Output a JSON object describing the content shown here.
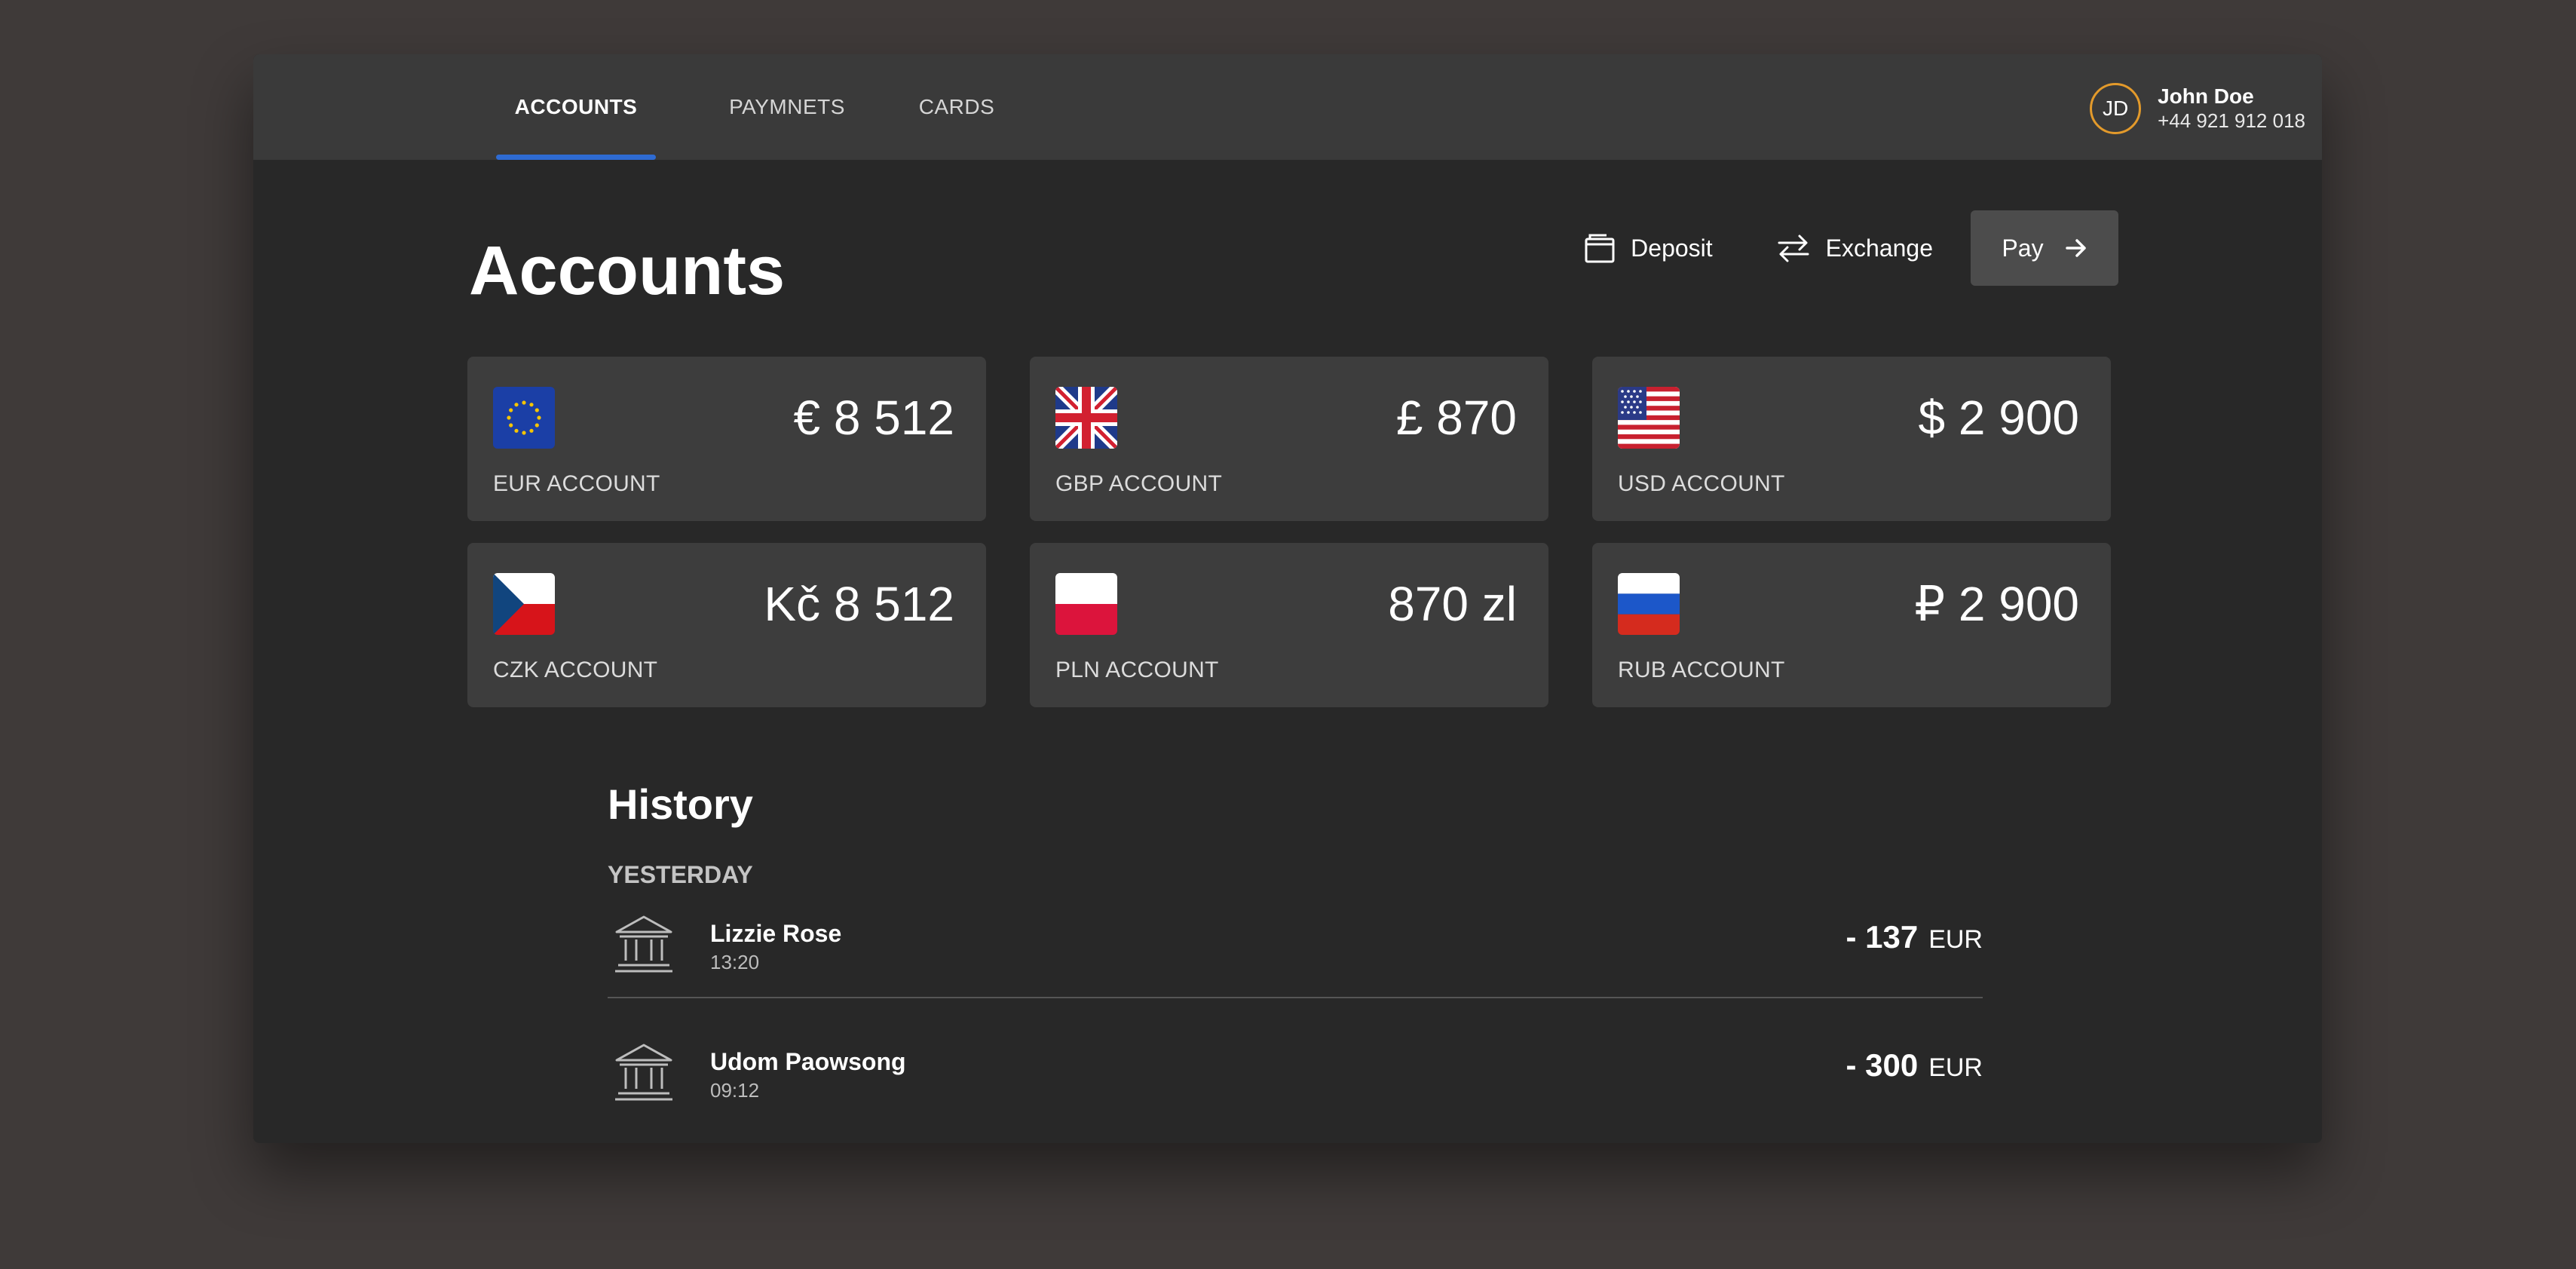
{
  "nav": {
    "tabs": [
      {
        "label": "ACCOUNTS",
        "active": true
      },
      {
        "label": "PAYMNETS",
        "active": false
      },
      {
        "label": "CARDS",
        "active": false
      }
    ]
  },
  "user": {
    "initials": "JD",
    "name": "John Doe",
    "phone": "+44 921 912 018"
  },
  "page": {
    "title": "Accounts"
  },
  "actions": {
    "deposit_label": "Deposit",
    "exchange_label": "Exchange",
    "pay_label": "Pay"
  },
  "accounts": [
    {
      "flag": "eu-flag-icon",
      "amount": "€ 8 512",
      "label": "EUR ACCOUNT"
    },
    {
      "flag": "uk-flag-icon",
      "amount": "£ 870",
      "label": "GBP ACCOUNT"
    },
    {
      "flag": "us-flag-icon",
      "amount": "$ 2 900",
      "label": "USD ACCOUNT"
    },
    {
      "flag": "cz-flag-icon",
      "amount": "Kč 8 512",
      "label": "CZK ACCOUNT"
    },
    {
      "flag": "pl-flag-icon",
      "amount": "870 zl",
      "label": "PLN ACCOUNT"
    },
    {
      "flag": "ru-flag-icon",
      "amount": "₽ 2 900",
      "label": "RUB ACCOUNT"
    }
  ],
  "history": {
    "title": "History",
    "groups": [
      {
        "label": "YESTERDAY",
        "transactions": [
          {
            "icon": "bank-icon",
            "name": "Lizzie Rose",
            "time": "13:20",
            "amount": "- 137",
            "currency": "EUR"
          },
          {
            "icon": "bank-icon",
            "name": "Udom Paowsong",
            "time": "09:12",
            "amount": "- 300",
            "currency": "EUR"
          }
        ]
      }
    ]
  },
  "colors": {
    "background": "#3f3a39",
    "app": "#282828",
    "topbar": "#3a3a3a",
    "card": "#3d3d3d",
    "accent": "#2e6bd3",
    "avatar_ring": "#e39a2b"
  }
}
